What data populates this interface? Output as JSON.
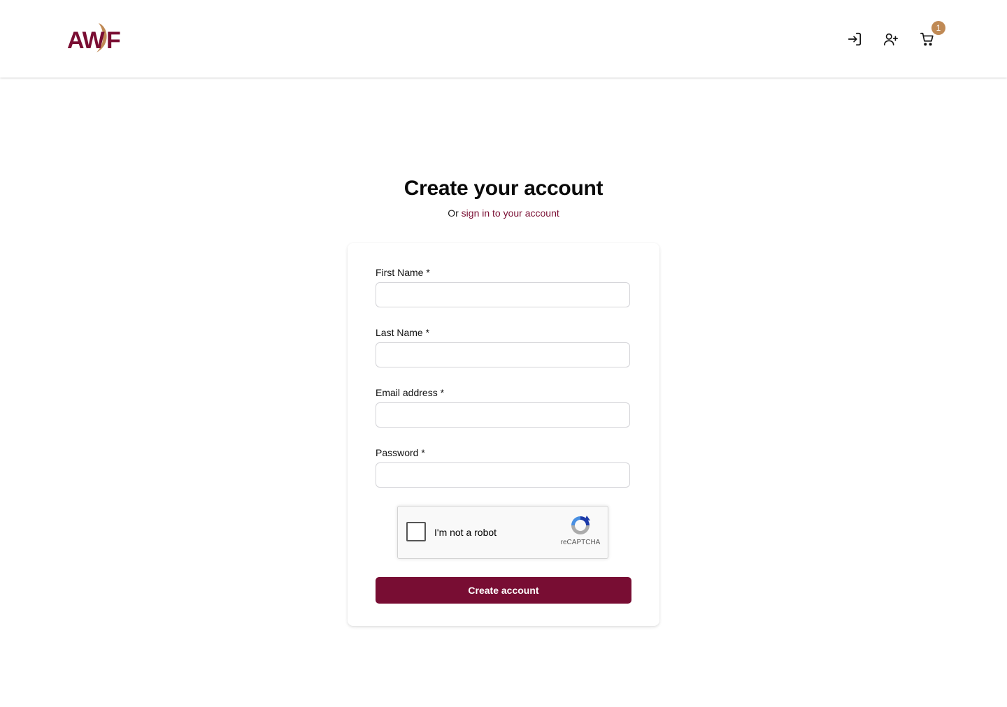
{
  "brand": {
    "logo_text": "AWF",
    "primary_color": "#780d33",
    "accent_color": "#c08a55"
  },
  "header": {
    "icons": {
      "signin": "sign-in-icon",
      "register": "user-plus-icon",
      "cart": "shopping-cart-icon"
    },
    "cart_count": "1"
  },
  "page": {
    "title": "Create your account",
    "subtitle_prefix": "Or",
    "signin_link": "sign in to your account"
  },
  "form": {
    "first_name": {
      "label": "First Name *",
      "value": ""
    },
    "last_name": {
      "label": "Last Name *",
      "value": ""
    },
    "email": {
      "label": "Email address *",
      "value": ""
    },
    "password": {
      "label": "Password *",
      "value": ""
    },
    "recaptcha": {
      "label": "I'm not a robot",
      "brand": "reCAPTCHA"
    },
    "submit_label": "Create account"
  }
}
